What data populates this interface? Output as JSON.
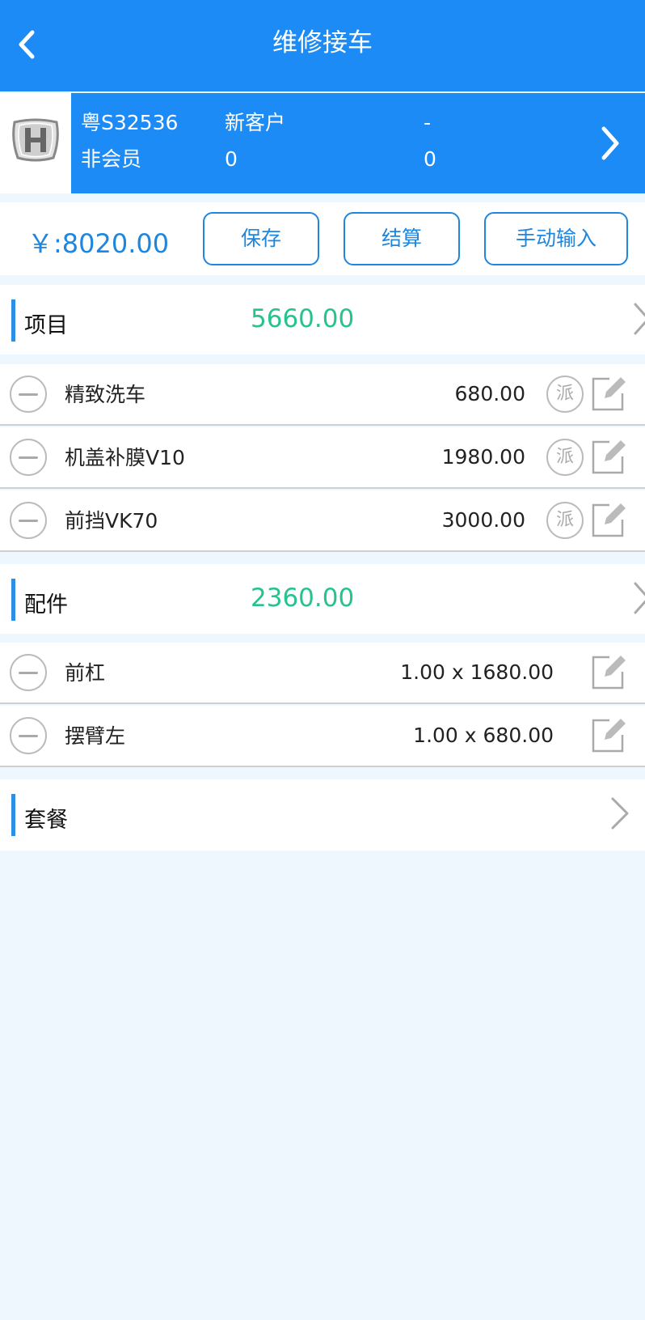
{
  "header": {
    "title": "维修接车"
  },
  "vehicle": {
    "plate": "粤S32536",
    "customer_type": "新客户",
    "field_dash": "-",
    "member_status": "非会员",
    "count_a": "0",
    "count_b": "0"
  },
  "actions": {
    "total": "￥:8020.00",
    "save": "保存",
    "settle": "结算",
    "manual_input": "手动输入"
  },
  "projects": {
    "label": "项目",
    "amount": "5660.00",
    "items": [
      {
        "name": "精致洗车",
        "price": "680.00",
        "dispatch": "派"
      },
      {
        "name": "机盖补膜V10",
        "price": "1980.00",
        "dispatch": "派"
      },
      {
        "name": "前挡VK70",
        "price": "3000.00",
        "dispatch": "派"
      }
    ]
  },
  "parts": {
    "label": "配件",
    "amount": "2360.00",
    "items": [
      {
        "name": "前杠",
        "qty_price": "1.00 x 1680.00"
      },
      {
        "name": "摆臂左",
        "qty_price": "1.00 x 680.00"
      }
    ]
  },
  "packages": {
    "label": "套餐"
  },
  "colors": {
    "primary": "#1c8bf5",
    "accent_green": "#26c28f",
    "text_blue": "#1f86de",
    "background": "#eef6fe"
  }
}
